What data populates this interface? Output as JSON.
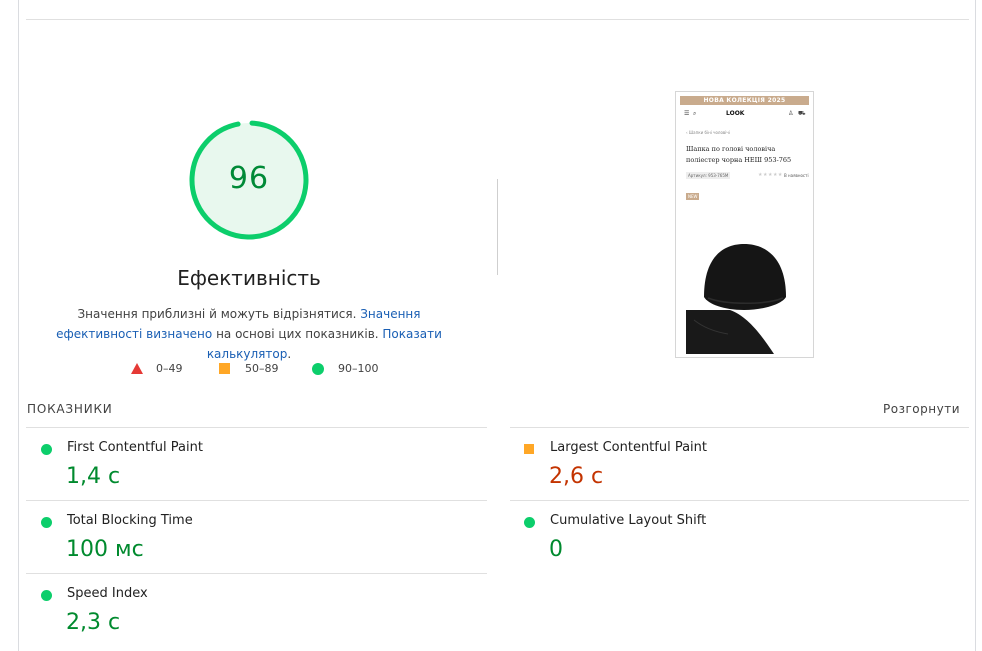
{
  "colors": {
    "good": "#0cce6b",
    "good_text": "#008a2e",
    "average": "#ffa726",
    "average_text": "#c33300",
    "poor": "#e53935",
    "link": "#1a5fb4"
  },
  "gauge": {
    "score": "96",
    "score_fraction": 0.96,
    "title": "Ефективність"
  },
  "note": {
    "text1": "Значення приблизні й можуть відрізнятися. ",
    "link1": "Значення ефективності визначено",
    "text2": " на основі цих показників. ",
    "link2": "Показати калькулятор",
    "text3": "."
  },
  "legend": [
    {
      "icon": "triangle-icon",
      "label": "0–49"
    },
    {
      "icon": "square-icon",
      "label": "50–89"
    },
    {
      "icon": "circle-icon",
      "label": "90–100"
    }
  ],
  "screenshot": {
    "banner": "НОВА КОЛЕКЦІЯ 2025",
    "logo": "LOOK",
    "breadcrumb": "‹ Шапки біні чоловічі",
    "product_title": "Шапка по голові чоловіча поліестер чорна НЕШ 953-765",
    "sku": "Артикул: 953-765М",
    "stock": "В наявності",
    "tag": "NEW"
  },
  "metrics": {
    "title": "ПОКАЗНИКИ",
    "expand": "Розгорнути",
    "items": [
      {
        "name": "First Contentful Paint",
        "value": "1,4 с",
        "rating": "good"
      },
      {
        "name": "Largest Contentful Paint",
        "value": "2,6 с",
        "rating": "average"
      },
      {
        "name": "Total Blocking Time",
        "value": "100 мс",
        "rating": "good"
      },
      {
        "name": "Cumulative Layout Shift",
        "value": "0",
        "rating": "good"
      },
      {
        "name": "Speed Index",
        "value": "2,3 с",
        "rating": "good"
      }
    ]
  }
}
